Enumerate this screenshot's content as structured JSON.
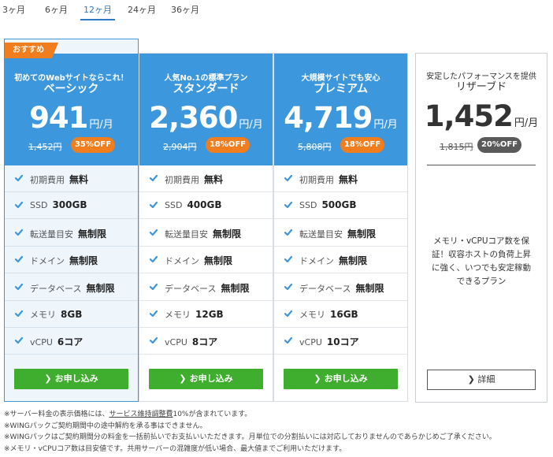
{
  "tabs": [
    {
      "label": "3ヶ月",
      "active": false
    },
    {
      "label": "6ヶ月",
      "active": false
    },
    {
      "label": "12ヶ月",
      "active": true
    },
    {
      "label": "24ヶ月",
      "active": false
    },
    {
      "label": "36ヶ月",
      "active": false
    }
  ],
  "colors": {
    "accent": "#3d97dc",
    "discount": "#f07d1e",
    "apply": "#3fad2d",
    "tab_active": "#2f78c4"
  },
  "feature_labels": [
    "初期費用",
    "SSD",
    "転送量目安",
    "ドメイン",
    "データベース",
    "メモリ",
    "vCPU"
  ],
  "plans": [
    {
      "ribbon": "おすすめ",
      "tag": "初めてのWebサイトならこれ！",
      "name": "ベーシック",
      "price": "941",
      "unit": "円/月",
      "old_price": "1,452円",
      "discount": "35%OFF",
      "features": [
        "無料",
        "300GB",
        "無制限",
        "無制限",
        "無制限",
        "8GB",
        "6コア"
      ],
      "apply_label": "お申し込み"
    },
    {
      "tag": "人気No.1の標準プラン",
      "name": "スタンダード",
      "price": "2,360",
      "unit": "円/月",
      "old_price": "2,904円",
      "discount": "18%OFF",
      "features": [
        "無料",
        "400GB",
        "無制限",
        "無制限",
        "無制限",
        "12GB",
        "8コア"
      ],
      "apply_label": "お申し込み"
    },
    {
      "tag": "大規模サイトでも安心",
      "name": "プレミアム",
      "price": "4,719",
      "unit": "円/月",
      "old_price": "5,808円",
      "discount": "18%OFF",
      "features": [
        "無料",
        "500GB",
        "無制限",
        "無制限",
        "無制限",
        "16GB",
        "10コア"
      ],
      "apply_label": "お申し込み"
    }
  ],
  "reserved": {
    "tag": "安定したパフォーマンスを提供",
    "name": "リザーブド",
    "price": "1,452",
    "unit": "円/月",
    "old_price": "1,815円",
    "discount": "20%OFF",
    "description": "メモリ・vCPUコア数を保証！収容ホストの負荷上昇に強く、いつでも安定稼動できるプラン",
    "detail_label": "詳細"
  },
  "notes": {
    "line1_pre": "※サーバー料金の表示価格には、",
    "line1_link": "サービス維持調整費",
    "line1_post": "10%が含まれています。",
    "line2": "※WINGパックご契約期間中の途中解約を承る事はできません。",
    "line3": "※WINGパックはご契約期間分の料金を一括前払いでお支払いいただきます。月単位での分割払いには対応しておりませんのであらかじめご了承ください。",
    "line4": "※メモリ・vCPUコア数は目安値です。共用サーバーの混雑度が低い場合、最大値までご利用いただけます。"
  }
}
